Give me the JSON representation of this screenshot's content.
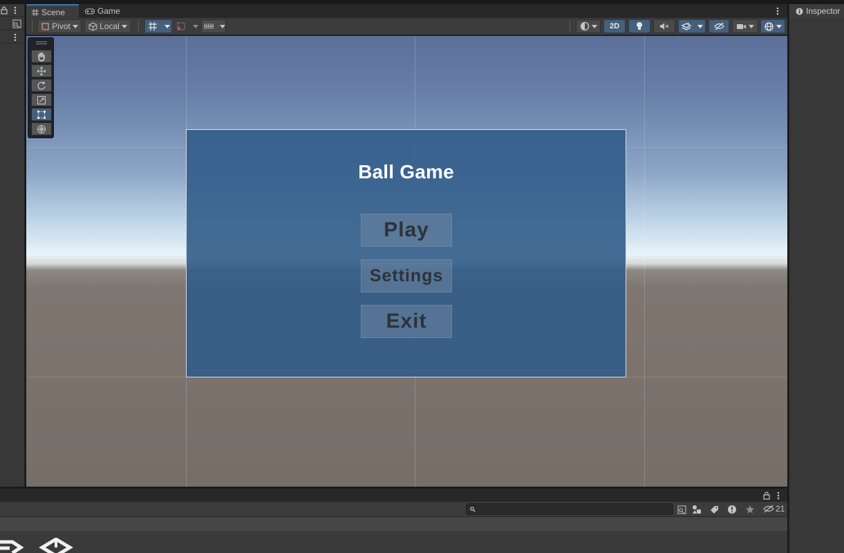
{
  "scene_tabs": {
    "scene": "Scene",
    "game": "Game"
  },
  "toolbar": {
    "pivot_label": "Pivot",
    "space_label": "Local",
    "mode_2d": "2D"
  },
  "game_ui": {
    "title": "Ball Game",
    "buttons": [
      {
        "label": "Play"
      },
      {
        "label": "Settings"
      },
      {
        "label": "Exit"
      }
    ]
  },
  "inspector": {
    "title": "Inspector"
  },
  "project": {
    "hidden_count": "21"
  },
  "colors": {
    "accent": "#3a79bb",
    "active_button": "#46607c",
    "canvas_fill": "#325d8a"
  }
}
